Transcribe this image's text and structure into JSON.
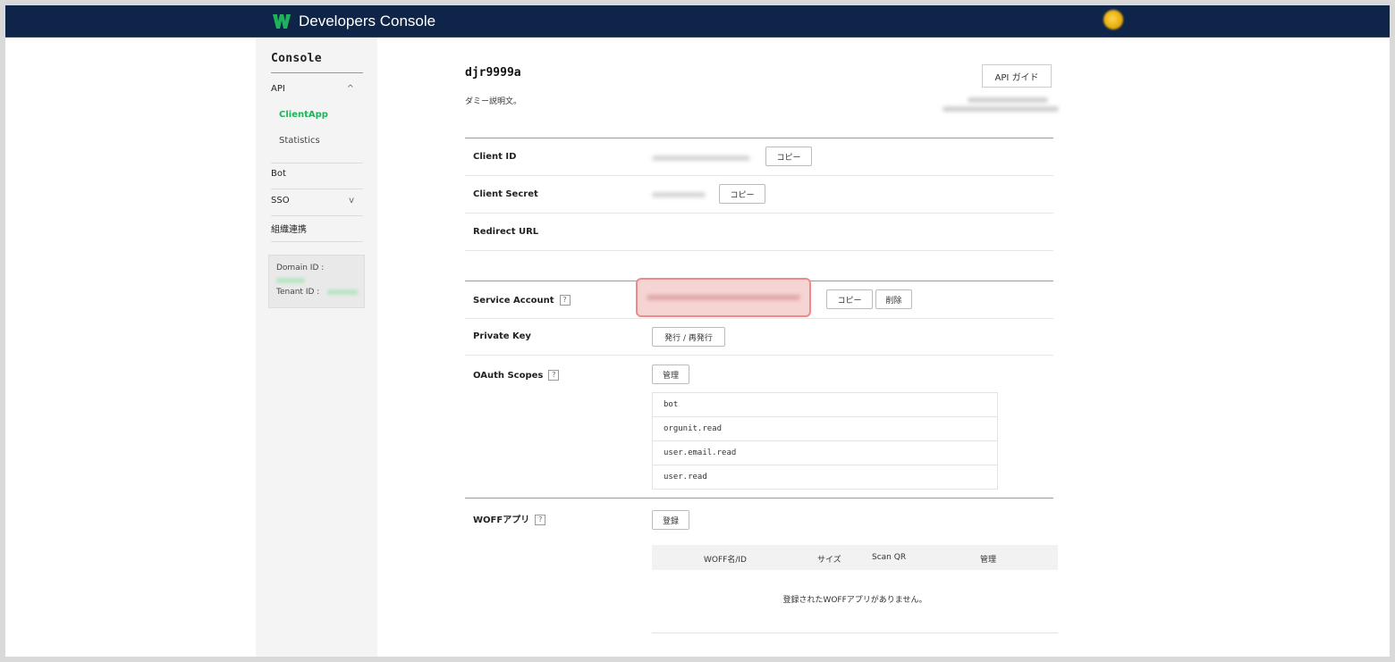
{
  "header": {
    "title": "Developers Console",
    "logo_color": "#1eb35a",
    "bg_color": "#0f2449"
  },
  "sidebar": {
    "title": "Console",
    "api": {
      "label": "API",
      "caret": "^"
    },
    "api_children": [
      {
        "label": "ClientApp",
        "active": true
      },
      {
        "label": "Statistics",
        "active": false
      }
    ],
    "bot": {
      "label": "Bot"
    },
    "sso": {
      "label": "SSO",
      "caret": "v"
    },
    "org": {
      "label": "組織連携"
    },
    "domain_label": "Domain ID :",
    "tenant_label": "Tenant ID :"
  },
  "app": {
    "name": "djr9999a",
    "description": "ダミー説明文。",
    "api_guide_label": "API ガイド"
  },
  "fields": {
    "client_id": {
      "label": "Client ID",
      "copy_label": "コピー"
    },
    "client_secret": {
      "label": "Client Secret",
      "copy_label": "コピー"
    },
    "redirect_url": {
      "label": "Redirect URL"
    },
    "service_account": {
      "label": "Service Account",
      "help": "?",
      "copy_label": "コピー",
      "delete_label": "削除"
    },
    "private_key": {
      "label": "Private Key",
      "issue_label": "発行 / 再発行"
    },
    "oauth_scopes": {
      "label": "OAuth Scopes",
      "help": "?",
      "manage_label": "管理",
      "scopes": [
        "bot",
        "orgunit.read",
        "user.email.read",
        "user.read"
      ]
    },
    "woff": {
      "label": "WOFFアプリ",
      "help": "?",
      "register_label": "登録",
      "columns": [
        "WOFF名/ID",
        "サイズ",
        "Scan QR",
        "管理"
      ],
      "empty_text": "登録されたWOFFアプリがありません。"
    }
  }
}
